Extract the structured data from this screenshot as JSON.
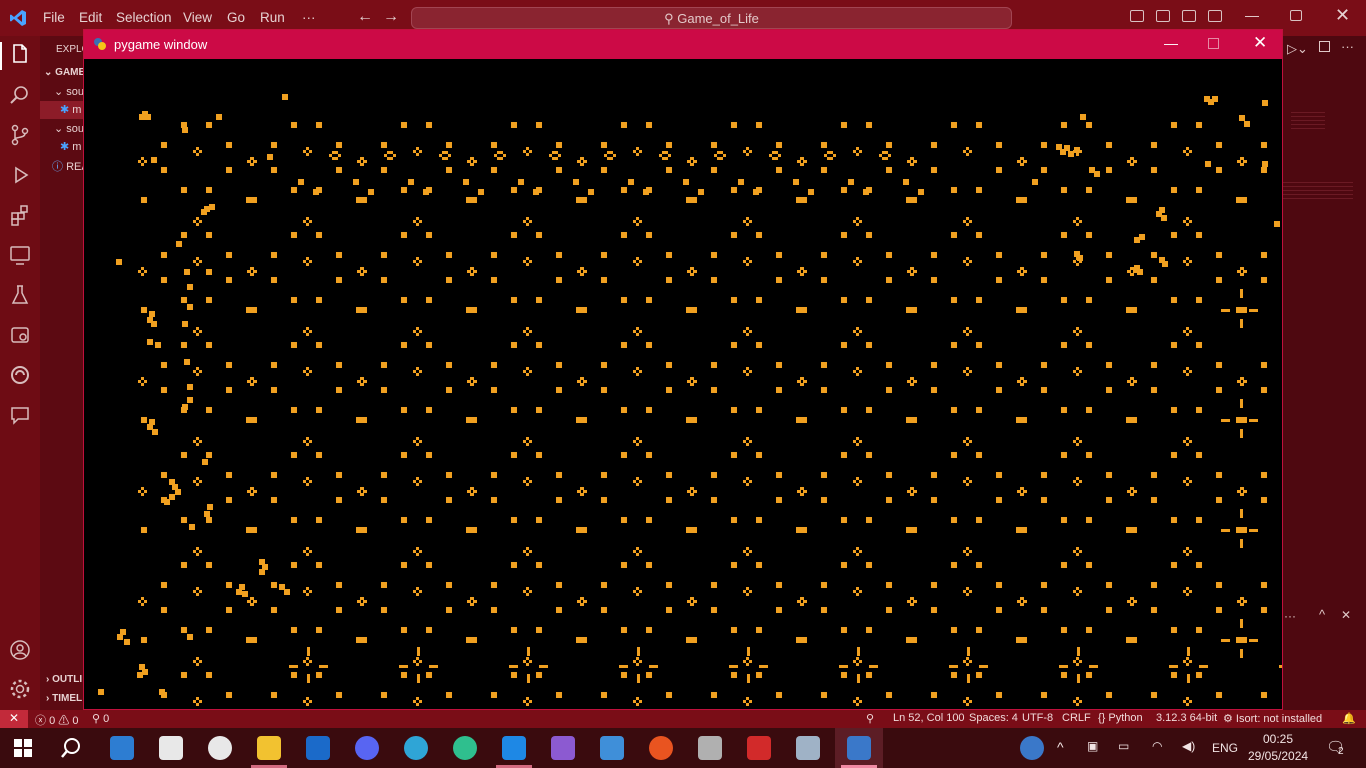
{
  "vscode": {
    "menu": [
      "File",
      "Edit",
      "Selection",
      "View",
      "Go",
      "Run",
      "···"
    ],
    "command_center": "Game_of_Life",
    "sidebar": {
      "title": "EXPLO",
      "rows": [
        "GAME",
        "sou",
        "m",
        "sou",
        "m",
        "REA"
      ],
      "outline": "OUTLI",
      "timeline": "TIMEL"
    },
    "statusbar": {
      "errors": "0",
      "warnings": "0",
      "ports": "0",
      "position": "Ln 52, Col 100",
      "spaces": "Spaces: 4",
      "encoding": "UTF-8",
      "eol": "CRLF",
      "language": "Python",
      "interpreter": "3.12.3 64-bit",
      "linter": "Isort: not installed"
    }
  },
  "pygame": {
    "title": "pygame window",
    "cell_color": "#f0a020"
  },
  "taskbar": {
    "language": "ENG",
    "time": "00:25",
    "date": "29/05/2024",
    "notifications": "2"
  }
}
